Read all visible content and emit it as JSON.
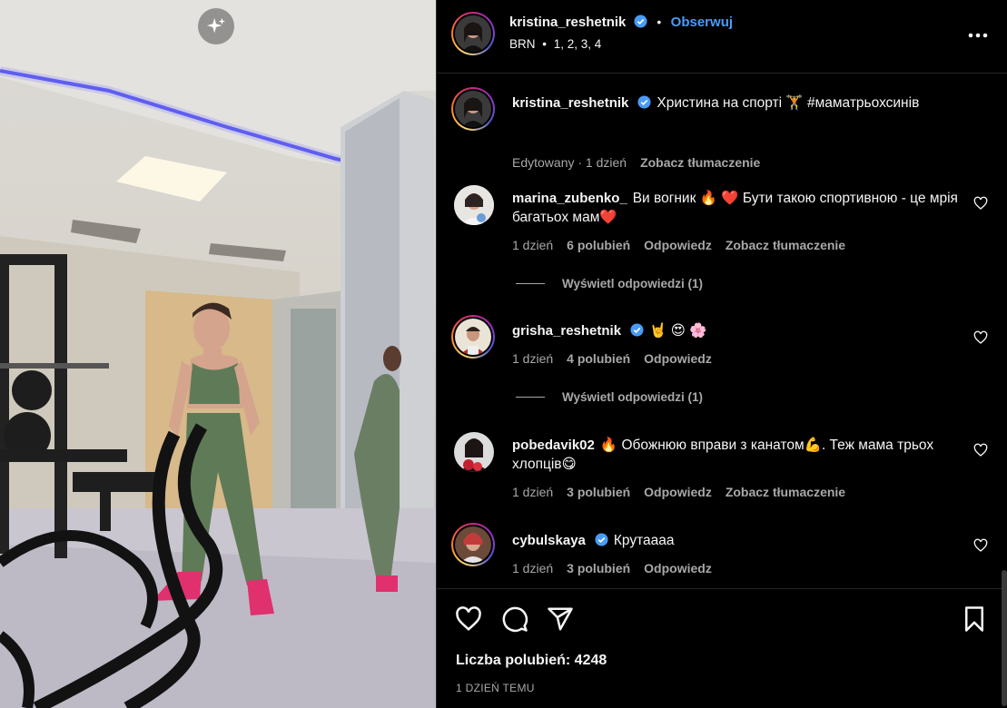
{
  "post": {
    "author": "kristina_reshetnik",
    "follow_label": "Obserwuj",
    "audio": "BRN",
    "audio_dot": "•",
    "tracks": "1, 2, 3, 4"
  },
  "caption": {
    "author": "kristina_reshetnik",
    "text": "Христина на спорті 🏋️ #маматрьохсинів",
    "edited": "Edytowany · 1 dzień",
    "translate": "Zobacz tłumaczenie"
  },
  "comments": [
    {
      "user": "marina_zubenko_",
      "text": "Ви вогник 🔥 ❤️  Бути такою спортивною - це мрія багатьох мам❤️",
      "time": "1 dzień",
      "likes": "6 polubień",
      "reply": "Odpowiedz",
      "translate": "Zobacz tłumaczenie",
      "view_replies": "Wyświetl odpowiedzi (1)"
    },
    {
      "user": "grisha_reshetnik",
      "verified": true,
      "text": "🤘 😍 🌸",
      "time": "1 dzień",
      "likes": "4 polubień",
      "reply": "Odpowiedz",
      "view_replies": "Wyświetl odpowiedzi (1)"
    },
    {
      "user": "pobedavik02",
      "text": "🔥 Обожнюю вправи з канатом💪. Теж мама трьох хлопців😋",
      "time": "1 dzień",
      "likes": "3 polubień",
      "reply": "Odpowiedz",
      "translate": "Zobacz tłumaczenie"
    },
    {
      "user": "cybulskaya",
      "verified": true,
      "text": "Крутаааа",
      "time": "1 dzień",
      "likes": "3 polubień",
      "reply": "Odpowiedz"
    }
  ],
  "footer": {
    "likes": "Liczba polubień: 4248",
    "time_ago": "1 DZIEŃ TEMU"
  },
  "colors": {
    "accent": "#4a9bf7",
    "secondary_text": "#a8a8a8",
    "background": "#000000"
  },
  "icons": [
    "sparkle-icon",
    "verified-icon",
    "more-icon",
    "heart-icon",
    "comment-icon",
    "share-icon",
    "bookmark-icon"
  ]
}
